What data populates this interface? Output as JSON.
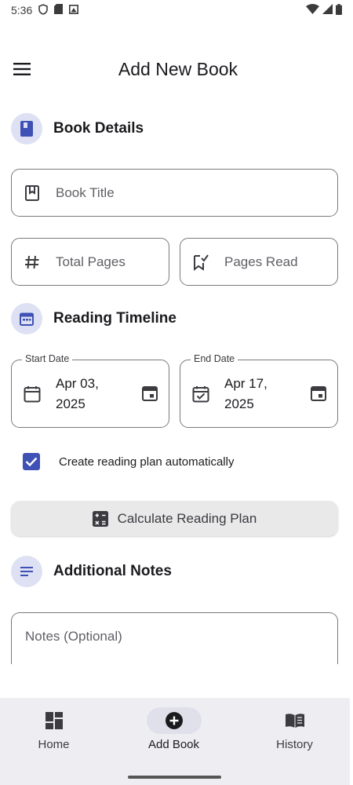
{
  "status_bar": {
    "time": "5:36"
  },
  "app_bar": {
    "title": "Add New Book"
  },
  "book_details": {
    "title": "Book Details",
    "book_title_placeholder": "Book Title",
    "total_pages_placeholder": "Total Pages",
    "pages_read_placeholder": "Pages Read"
  },
  "reading_timeline": {
    "title": "Reading Timeline",
    "start_label": "Start Date",
    "start_value": "Apr 03, 2025",
    "end_label": "End Date",
    "end_value": "Apr 17, 2025"
  },
  "plan": {
    "checkbox_label": "Create reading plan automatically",
    "checked": true,
    "button_label": "Calculate Reading Plan"
  },
  "notes": {
    "title": "Additional Notes",
    "placeholder": "Notes (Optional)"
  },
  "bottom_nav": {
    "items": [
      {
        "label": "Home",
        "icon": "dashboard-icon",
        "active": false
      },
      {
        "label": "Add Book",
        "icon": "add-circle-icon",
        "active": true
      },
      {
        "label": "History",
        "icon": "book-open-icon",
        "active": false
      }
    ]
  },
  "colors": {
    "accent": "#3f51b5",
    "icon_bg": "#dde1f3",
    "nav_bg": "#eeeef2"
  }
}
